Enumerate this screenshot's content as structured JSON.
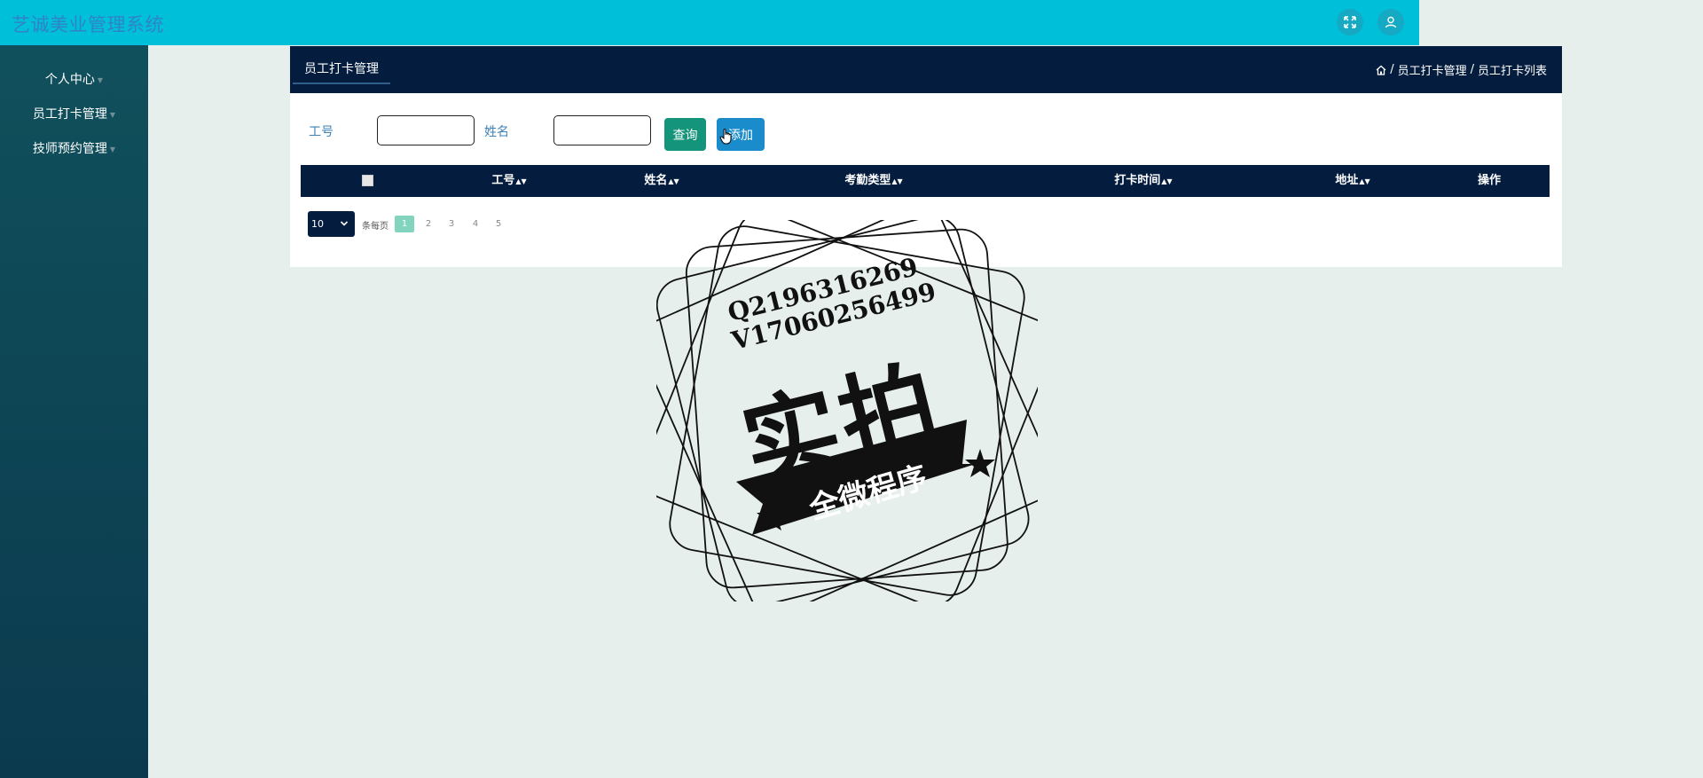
{
  "app": {
    "title": "艺诚美业管理系统"
  },
  "top_actions": [
    {
      "icon": "fullscreen-icon"
    },
    {
      "icon": "user-icon"
    }
  ],
  "sidebar": {
    "items": [
      {
        "label": "个人中心"
      },
      {
        "label": "员工打卡管理"
      },
      {
        "label": "技师预约管理"
      }
    ]
  },
  "panel": {
    "tab": "员工打卡管理",
    "breadcrumb": [
      "员工打卡管理",
      "员工打卡列表"
    ],
    "breadcrumb_sep": "/"
  },
  "search": {
    "field1_label": "工号",
    "field1_value": "",
    "field2_label": "姓名",
    "field2_value": "",
    "query_label": "查询",
    "add_label": "添加"
  },
  "table": {
    "columns": [
      "工号",
      "姓名",
      "考勤类型",
      "打卡时间",
      "地址",
      "操作"
    ],
    "rows": []
  },
  "pagination": {
    "page_size": "10",
    "per_page_text": "条每页",
    "pages": [
      "1",
      "2",
      "3",
      "4",
      "5"
    ],
    "current": "1"
  },
  "watermark": {
    "line1": "Q2196316269",
    "line2": "V17060256499",
    "big": "实拍",
    "ribbon": "全微程序"
  },
  "colors": {
    "topbar": "#00bfd9",
    "sidebar": "#0b3a4e",
    "panel_header": "#041d3f",
    "query_button": "#14947a",
    "add_button": "#1b8ccb",
    "active_page": "#82d4bf"
  }
}
